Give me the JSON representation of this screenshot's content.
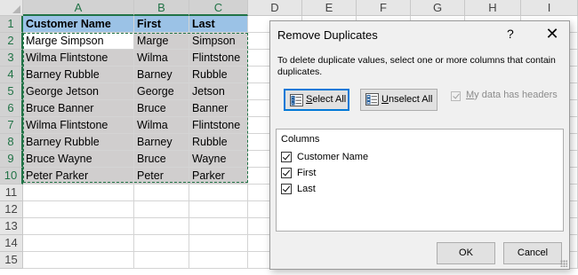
{
  "sheet": {
    "columns": [
      "A",
      "B",
      "C",
      "D",
      "E",
      "F",
      "G",
      "H",
      "I"
    ],
    "rows": [
      "1",
      "2",
      "3",
      "4",
      "5",
      "6",
      "7",
      "8",
      "9",
      "10",
      "11",
      "12",
      "13",
      "14",
      "15"
    ],
    "header": [
      "Customer Name",
      "First",
      "Last"
    ],
    "data": [
      [
        "Marge Simpson",
        "Marge",
        "Simpson"
      ],
      [
        "Wilma Flintstone",
        "Wilma",
        "Flintstone"
      ],
      [
        "Barney Rubble",
        "Barney",
        "Rubble"
      ],
      [
        "George Jetson",
        "George",
        "Jetson"
      ],
      [
        "Bruce Banner",
        "Bruce",
        "Banner"
      ],
      [
        "Wilma Flintstone",
        "Wilma",
        "Flintstone"
      ],
      [
        "Barney Rubble",
        "Barney",
        "Rubble"
      ],
      [
        "Bruce Wayne",
        "Bruce",
        "Wayne"
      ],
      [
        "Peter Parker",
        "Peter",
        "Parker"
      ]
    ],
    "colors": {
      "header_fill": "#9bc2e6",
      "data_fill": "#d0cece",
      "selection": "#217346"
    }
  },
  "dialog": {
    "title": "Remove Duplicates",
    "help": "?",
    "close": "✕",
    "description": "To delete duplicate values, select one or more columns that contain duplicates.",
    "select_all_pre": "",
    "select_all_ul": "S",
    "select_all_post": "elect All",
    "unselect_all_pre": "",
    "unselect_all_ul": "U",
    "unselect_all_post": "nselect All",
    "headers_pre": "",
    "headers_ul": "M",
    "headers_post": "y data has headers",
    "headers_checked": true,
    "columns_label": "Columns",
    "columns": [
      {
        "label": "Customer Name",
        "checked": true
      },
      {
        "label": "First",
        "checked": true
      },
      {
        "label": "Last",
        "checked": true
      }
    ],
    "ok_label": "OK",
    "cancel_label": "Cancel"
  }
}
